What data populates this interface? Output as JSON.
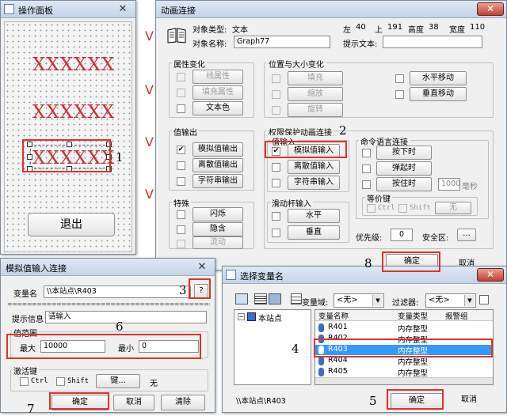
{
  "panel": {
    "title": "操作面板",
    "xx1": "XXXXXX",
    "xx2": "XXXXXX",
    "xx3": "XXXXXX",
    "exit_label": "退出"
  },
  "anim": {
    "title": "动画连接",
    "obj_type_label": "对象类型:",
    "obj_type": "文本",
    "left_label": "左",
    "left": "40",
    "top_label": "上",
    "top": "191",
    "height_label": "高度",
    "height": "38",
    "width_label": "宽度",
    "width": "110",
    "obj_name_label": "对象名称:",
    "obj_name": "Graph77",
    "tip_label": "提示文本:",
    "attr_group": "属性变化",
    "line_attr": "线属性",
    "fill_attr": "填充属性",
    "text_color": "文本色",
    "pos_group": "位置与大小变化",
    "fill": "填充",
    "scale": "缩放",
    "rotate": "旋转",
    "hmove": "水平移动",
    "vmove": "垂直移动",
    "out_group": "值输出",
    "analog_out": "模拟值输出",
    "discrete_out": "离散值输出",
    "string_out": "字符串输出",
    "perm_group": "权限保护动画连接",
    "in_group": "值输入",
    "analog_in": "模拟值输入",
    "discrete_in": "离散值输入",
    "string_in": "字符串输入",
    "cmd_group": "命令语言连接",
    "press": "按下时",
    "release": "弹起时",
    "hold": "按住时",
    "hold_ms": "1000",
    "ms_unit": "毫秒",
    "equiv_group": "等价键",
    "ctrl": "Ctrl",
    "shift": "Shift",
    "none": "无",
    "special_group": "特殊",
    "flash": "闪烁",
    "hide": "隐含",
    "flow": "流动",
    "slider_group": "滑动杆输入",
    "horizontal": "水平",
    "vertical": "垂直",
    "priority_label": "优先级:",
    "priority": "0",
    "security_label": "安全区:",
    "security_btn": "...",
    "ok": "确定",
    "cancel": "取消"
  },
  "ainput": {
    "title": "模拟值输入连接",
    "var_label": "变量名",
    "var_value": "\\\\本站点\\R403",
    "q_btn": "?",
    "sep": "=============================================",
    "tip_label": "提示信息",
    "tip_value": "请输入",
    "range_group": "值范围",
    "max_label": "最大",
    "max_value": "10000",
    "min_label": "最小",
    "min_value": "0",
    "act_group": "激活键",
    "ctrl": "Ctrl",
    "shift": "Shift",
    "key_btn": "键...",
    "none": "无",
    "ok": "确定",
    "cancel": "取消",
    "clear": "清除"
  },
  "varsel": {
    "title": "选择变量名",
    "field_label": "变量域:",
    "field_value": "<无>",
    "filter_label": "过滤器:",
    "filter_value": "<无>",
    "tree_root": "本站点",
    "col_name": "变量名称",
    "col_type": "变量类型",
    "col_alarm": "报警组",
    "rows": [
      {
        "name": "R401",
        "type": "内存整型"
      },
      {
        "name": "R402",
        "type": "内存整型"
      },
      {
        "name": "R403",
        "type": "内存整型"
      },
      {
        "name": "R404",
        "type": "内存整型"
      },
      {
        "name": "R405",
        "type": "内存整型"
      }
    ],
    "path": "\\\\本站点\\R403",
    "ok": "确定",
    "cancel": "取消"
  },
  "markers": {
    "m1": "1",
    "m2": "2",
    "m3": "3",
    "m4": "4",
    "m5": "5",
    "m6": "6",
    "m7": "7",
    "m8": "8"
  },
  "bg": {
    "right_char": "即",
    "partial": "V"
  },
  "colors": {
    "highlight": "#e0322a",
    "selection": "#3399ff",
    "xx_text": "#c83232"
  }
}
